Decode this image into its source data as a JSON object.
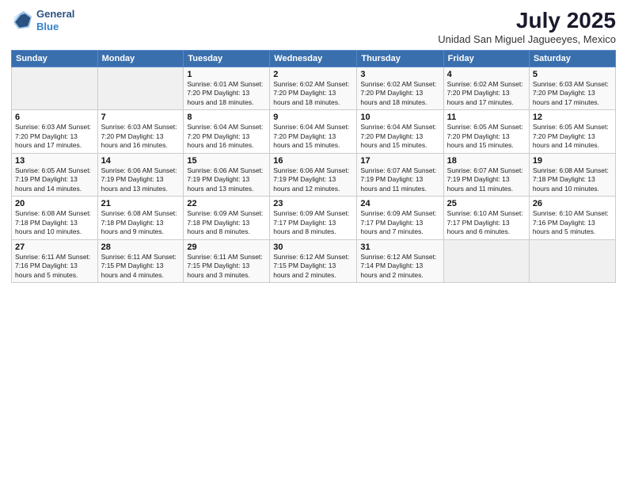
{
  "header": {
    "logo_line1": "General",
    "logo_line2": "Blue",
    "month_year": "July 2025",
    "location": "Unidad San Miguel Jagueeyes, Mexico"
  },
  "weekdays": [
    "Sunday",
    "Monday",
    "Tuesday",
    "Wednesday",
    "Thursday",
    "Friday",
    "Saturday"
  ],
  "weeks": [
    [
      {
        "day": "",
        "info": ""
      },
      {
        "day": "",
        "info": ""
      },
      {
        "day": "1",
        "info": "Sunrise: 6:01 AM\nSunset: 7:20 PM\nDaylight: 13 hours\nand 18 minutes."
      },
      {
        "day": "2",
        "info": "Sunrise: 6:02 AM\nSunset: 7:20 PM\nDaylight: 13 hours\nand 18 minutes."
      },
      {
        "day": "3",
        "info": "Sunrise: 6:02 AM\nSunset: 7:20 PM\nDaylight: 13 hours\nand 18 minutes."
      },
      {
        "day": "4",
        "info": "Sunrise: 6:02 AM\nSunset: 7:20 PM\nDaylight: 13 hours\nand 17 minutes."
      },
      {
        "day": "5",
        "info": "Sunrise: 6:03 AM\nSunset: 7:20 PM\nDaylight: 13 hours\nand 17 minutes."
      }
    ],
    [
      {
        "day": "6",
        "info": "Sunrise: 6:03 AM\nSunset: 7:20 PM\nDaylight: 13 hours\nand 17 minutes."
      },
      {
        "day": "7",
        "info": "Sunrise: 6:03 AM\nSunset: 7:20 PM\nDaylight: 13 hours\nand 16 minutes."
      },
      {
        "day": "8",
        "info": "Sunrise: 6:04 AM\nSunset: 7:20 PM\nDaylight: 13 hours\nand 16 minutes."
      },
      {
        "day": "9",
        "info": "Sunrise: 6:04 AM\nSunset: 7:20 PM\nDaylight: 13 hours\nand 15 minutes."
      },
      {
        "day": "10",
        "info": "Sunrise: 6:04 AM\nSunset: 7:20 PM\nDaylight: 13 hours\nand 15 minutes."
      },
      {
        "day": "11",
        "info": "Sunrise: 6:05 AM\nSunset: 7:20 PM\nDaylight: 13 hours\nand 15 minutes."
      },
      {
        "day": "12",
        "info": "Sunrise: 6:05 AM\nSunset: 7:20 PM\nDaylight: 13 hours\nand 14 minutes."
      }
    ],
    [
      {
        "day": "13",
        "info": "Sunrise: 6:05 AM\nSunset: 7:19 PM\nDaylight: 13 hours\nand 14 minutes."
      },
      {
        "day": "14",
        "info": "Sunrise: 6:06 AM\nSunset: 7:19 PM\nDaylight: 13 hours\nand 13 minutes."
      },
      {
        "day": "15",
        "info": "Sunrise: 6:06 AM\nSunset: 7:19 PM\nDaylight: 13 hours\nand 13 minutes."
      },
      {
        "day": "16",
        "info": "Sunrise: 6:06 AM\nSunset: 7:19 PM\nDaylight: 13 hours\nand 12 minutes."
      },
      {
        "day": "17",
        "info": "Sunrise: 6:07 AM\nSunset: 7:19 PM\nDaylight: 13 hours\nand 11 minutes."
      },
      {
        "day": "18",
        "info": "Sunrise: 6:07 AM\nSunset: 7:19 PM\nDaylight: 13 hours\nand 11 minutes."
      },
      {
        "day": "19",
        "info": "Sunrise: 6:08 AM\nSunset: 7:18 PM\nDaylight: 13 hours\nand 10 minutes."
      }
    ],
    [
      {
        "day": "20",
        "info": "Sunrise: 6:08 AM\nSunset: 7:18 PM\nDaylight: 13 hours\nand 10 minutes."
      },
      {
        "day": "21",
        "info": "Sunrise: 6:08 AM\nSunset: 7:18 PM\nDaylight: 13 hours\nand 9 minutes."
      },
      {
        "day": "22",
        "info": "Sunrise: 6:09 AM\nSunset: 7:18 PM\nDaylight: 13 hours\nand 8 minutes."
      },
      {
        "day": "23",
        "info": "Sunrise: 6:09 AM\nSunset: 7:17 PM\nDaylight: 13 hours\nand 8 minutes."
      },
      {
        "day": "24",
        "info": "Sunrise: 6:09 AM\nSunset: 7:17 PM\nDaylight: 13 hours\nand 7 minutes."
      },
      {
        "day": "25",
        "info": "Sunrise: 6:10 AM\nSunset: 7:17 PM\nDaylight: 13 hours\nand 6 minutes."
      },
      {
        "day": "26",
        "info": "Sunrise: 6:10 AM\nSunset: 7:16 PM\nDaylight: 13 hours\nand 5 minutes."
      }
    ],
    [
      {
        "day": "27",
        "info": "Sunrise: 6:11 AM\nSunset: 7:16 PM\nDaylight: 13 hours\nand 5 minutes."
      },
      {
        "day": "28",
        "info": "Sunrise: 6:11 AM\nSunset: 7:15 PM\nDaylight: 13 hours\nand 4 minutes."
      },
      {
        "day": "29",
        "info": "Sunrise: 6:11 AM\nSunset: 7:15 PM\nDaylight: 13 hours\nand 3 minutes."
      },
      {
        "day": "30",
        "info": "Sunrise: 6:12 AM\nSunset: 7:15 PM\nDaylight: 13 hours\nand 2 minutes."
      },
      {
        "day": "31",
        "info": "Sunrise: 6:12 AM\nSunset: 7:14 PM\nDaylight: 13 hours\nand 2 minutes."
      },
      {
        "day": "",
        "info": ""
      },
      {
        "day": "",
        "info": ""
      }
    ]
  ]
}
